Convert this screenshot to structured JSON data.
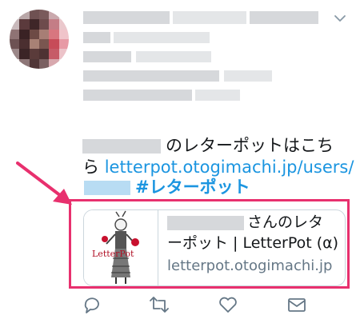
{
  "tweet": {
    "line1_suffix": "のレターポットはこち",
    "line2_prefix": "ら ",
    "link_text": "letterpot.otogimachi.jp/users/",
    "hashtag": "#レターポット"
  },
  "card": {
    "title_line1_suffix": "さんのレタ",
    "title_line2": "ーポット | LetterPot (α)",
    "domain": "letterpot.otogimachi.jp",
    "logo_text": "LetterPot"
  },
  "colors": {
    "link": "#1b95e0",
    "highlight": "#e8306e",
    "muted": "#657786"
  },
  "icons": {
    "menu": "chevron-down-icon",
    "reply": "reply-icon",
    "retweet": "retweet-icon",
    "like": "heart-icon",
    "share": "envelope-icon"
  }
}
